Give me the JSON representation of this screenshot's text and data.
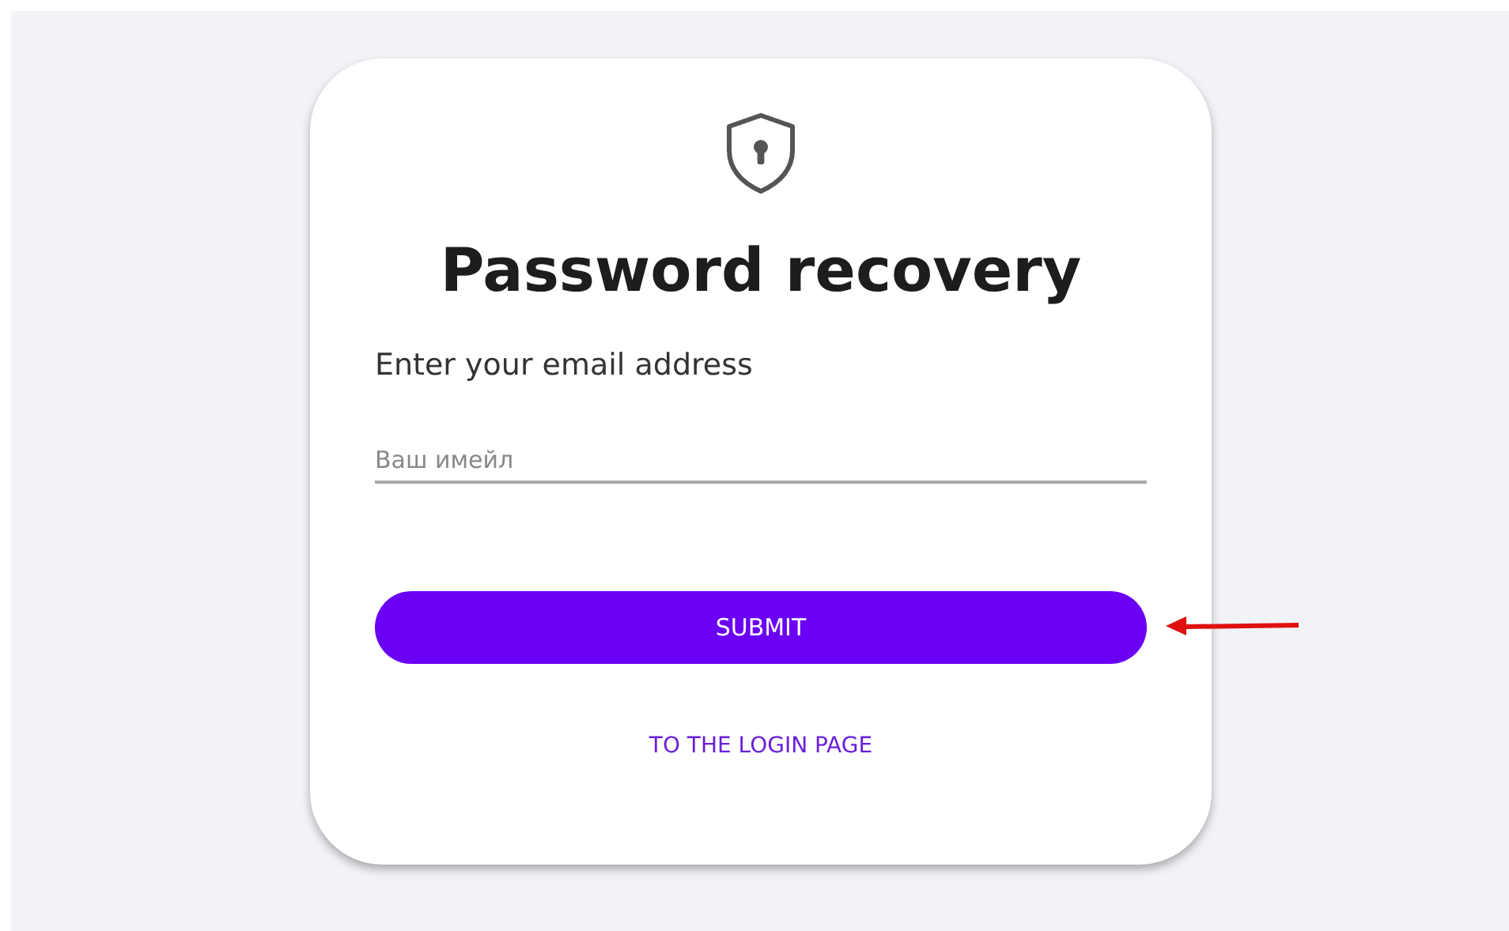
{
  "card": {
    "title": "Password recovery",
    "label": "Enter your email address",
    "email_field": {
      "placeholder": "Ваш имейл"
    },
    "submit_button": "SUBMIT",
    "login_link": "TO THE LOGIN PAGE"
  }
}
